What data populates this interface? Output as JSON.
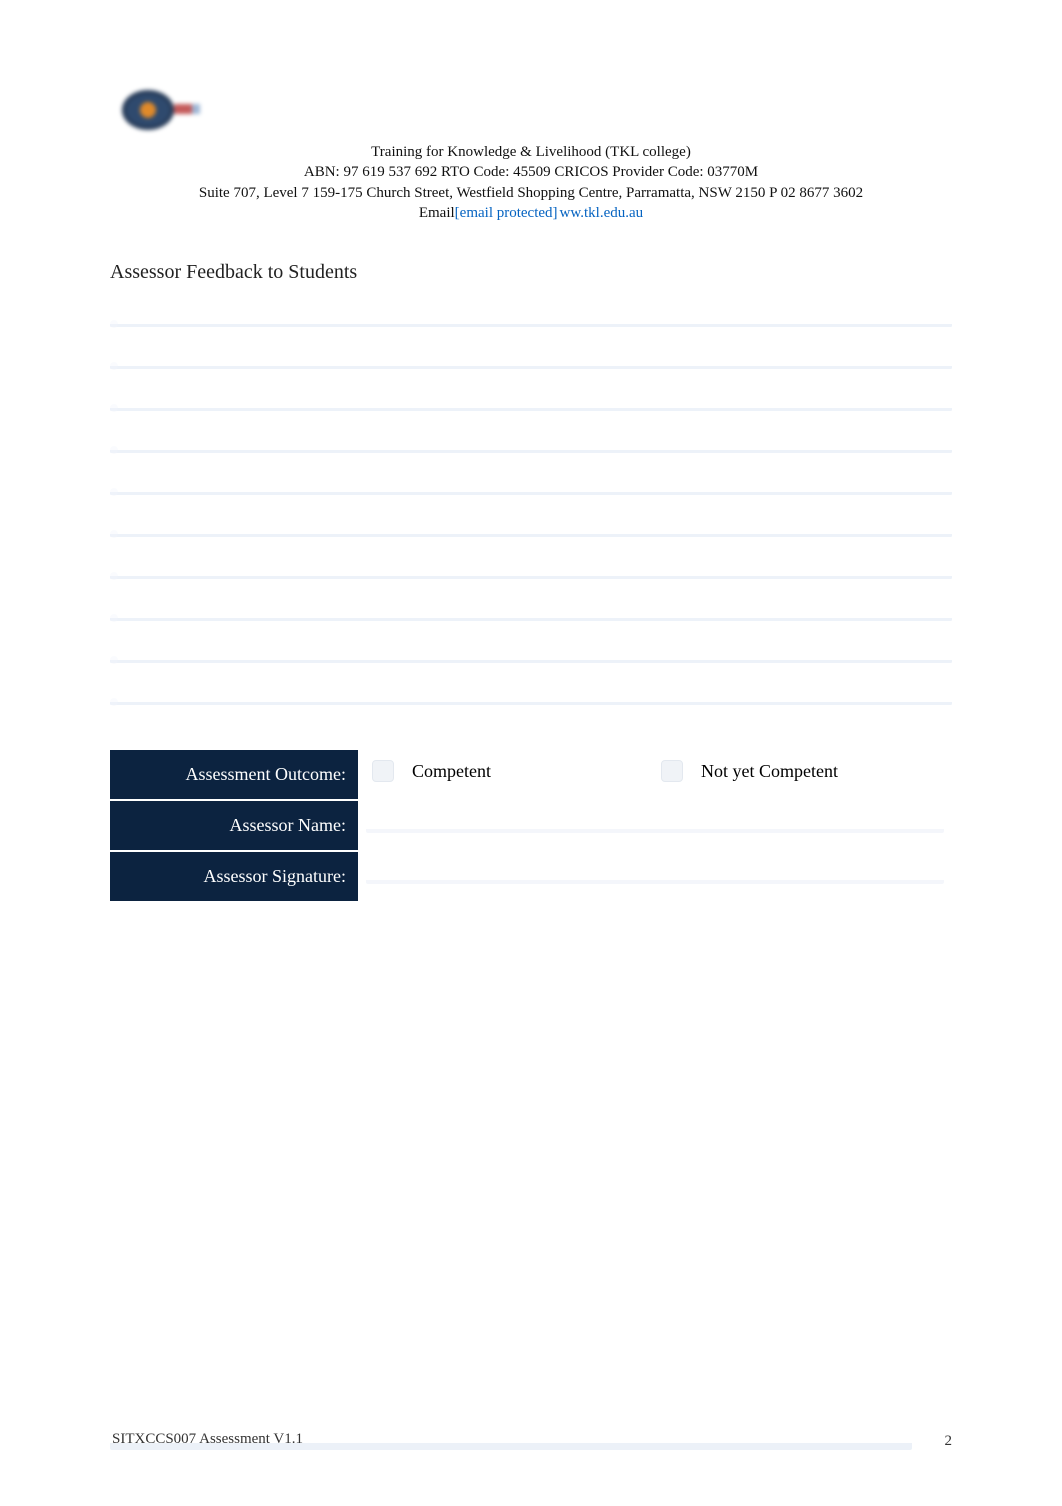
{
  "header": {
    "org_name": "Training for Knowledge & Livelihood (TKL college)",
    "abn_line": "ABN: 97 619 537 692 RTO Code: 45509 CRICOS Provider Code: 03770M",
    "address_line": "Suite 707, Level 7 159-175 Church Street, Westfield Shopping Centre, Parramatta, NSW 2150 P 02 8677 3602",
    "email_label": "Email",
    "email_link_text": "[email protected]",
    "website_link_text": "ww.tkl.edu.au"
  },
  "section": {
    "title": "Assessor Feedback to Students"
  },
  "outcome": {
    "row_label": "Assessment Outcome:",
    "competent_label": "Competent",
    "not_competent_label": "Not yet Competent",
    "assessor_name_label": "Assessor Name:",
    "assessor_signature_label": "Assessor Signature:"
  },
  "footer": {
    "left": "SITXCCS007 Assessment V1.1",
    "page_number": "2"
  }
}
